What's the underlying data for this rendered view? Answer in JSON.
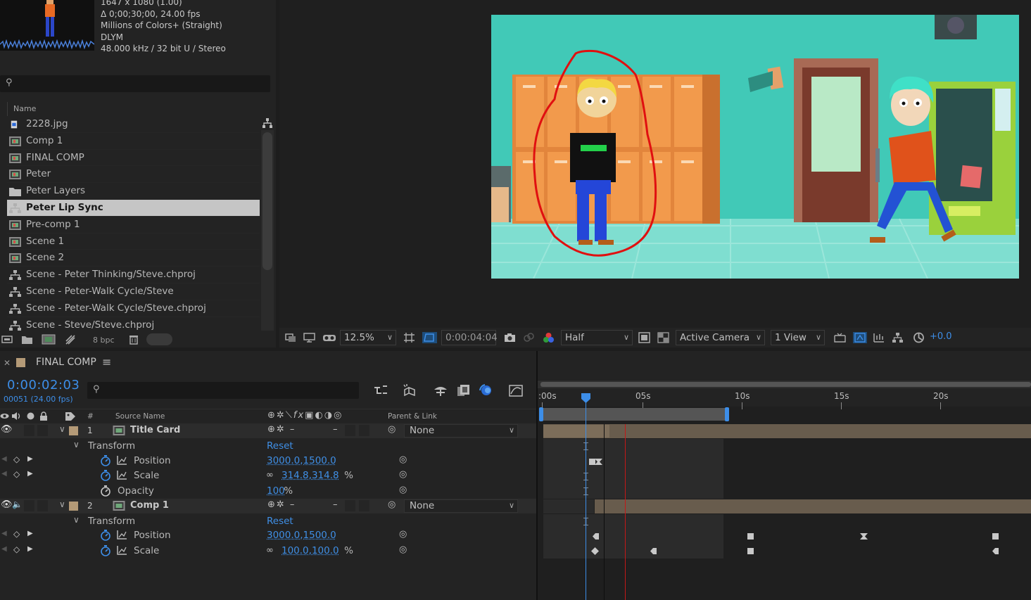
{
  "project": {
    "footage_info": [
      "1647 x 1080 (1.00)",
      "Δ 0;00;30;00, 24.00 fps",
      "Millions of Colors+ (Straight)",
      "DLYM",
      "48.000 kHz / 32 bit U / Stereo"
    ],
    "search_placeholder": "",
    "column_name": "Name",
    "items": [
      {
        "label": "2228.jpg",
        "icon": "image-file-icon"
      },
      {
        "label": "Comp 1",
        "icon": "composition-icon"
      },
      {
        "label": "FINAL COMP",
        "icon": "composition-icon"
      },
      {
        "label": "Peter",
        "icon": "composition-icon"
      },
      {
        "label": "Peter Layers",
        "icon": "folder-icon"
      },
      {
        "label": "Peter Lip Sync",
        "icon": "linked-project-icon",
        "selected": true
      },
      {
        "label": "Pre-comp 1",
        "icon": "composition-icon"
      },
      {
        "label": "Scene 1",
        "icon": "composition-icon"
      },
      {
        "label": "Scene 2",
        "icon": "composition-icon"
      },
      {
        "label": "Scene - Peter Thinking/Steve.chproj",
        "icon": "linked-project-icon"
      },
      {
        "label": "Scene - Peter-Walk Cycle/Steve",
        "icon": "linked-project-icon"
      },
      {
        "label": "Scene - Peter-Walk Cycle/Steve.chproj",
        "icon": "linked-project-icon"
      },
      {
        "label": "Scene - Steve/Steve.chproj",
        "icon": "linked-project-icon"
      }
    ],
    "bit_depth": "8 bpc"
  },
  "viewer": {
    "zoom": "12.5%",
    "timecode": "0:00:04:04",
    "resolution": "Half",
    "camera": "Active Camera",
    "views": "1 View",
    "exposure": "+0.0"
  },
  "timeline": {
    "comp_name": "FINAL COMP",
    "current_time": "0:00:02:03",
    "frame_info": "00051 (24.00 fps)",
    "search_placeholder": "",
    "headers": {
      "number": "#",
      "source_name": "Source Name",
      "parent_link": "Parent & Link"
    },
    "ruler_labels": [
      ":00s",
      "05s",
      "10s",
      "15s",
      "20s"
    ],
    "layers": [
      {
        "number": "1",
        "name": "Title Card",
        "parent": "None",
        "transform_label": "Transform",
        "reset_label": "Reset",
        "properties": [
          {
            "name": "Position",
            "value": "3000.0,1500.0",
            "unit": ""
          },
          {
            "name": "Scale",
            "value": "314.8,314.8",
            "unit": "%"
          },
          {
            "name": "Opacity",
            "value": "100",
            "unit": "%"
          }
        ]
      },
      {
        "number": "2",
        "name": "Comp 1",
        "parent": "None",
        "transform_label": "Transform",
        "reset_label": "Reset",
        "properties": [
          {
            "name": "Position",
            "value": "3000.0,1500.0",
            "unit": ""
          },
          {
            "name": "Scale",
            "value": "100.0,100.0",
            "unit": "%"
          }
        ]
      }
    ]
  },
  "colors": {
    "accent_blue": "#3d8ee8",
    "label_tan": "#b49a77",
    "annotation_red": "#e01010",
    "scene_teal": "#3fc7b5"
  }
}
